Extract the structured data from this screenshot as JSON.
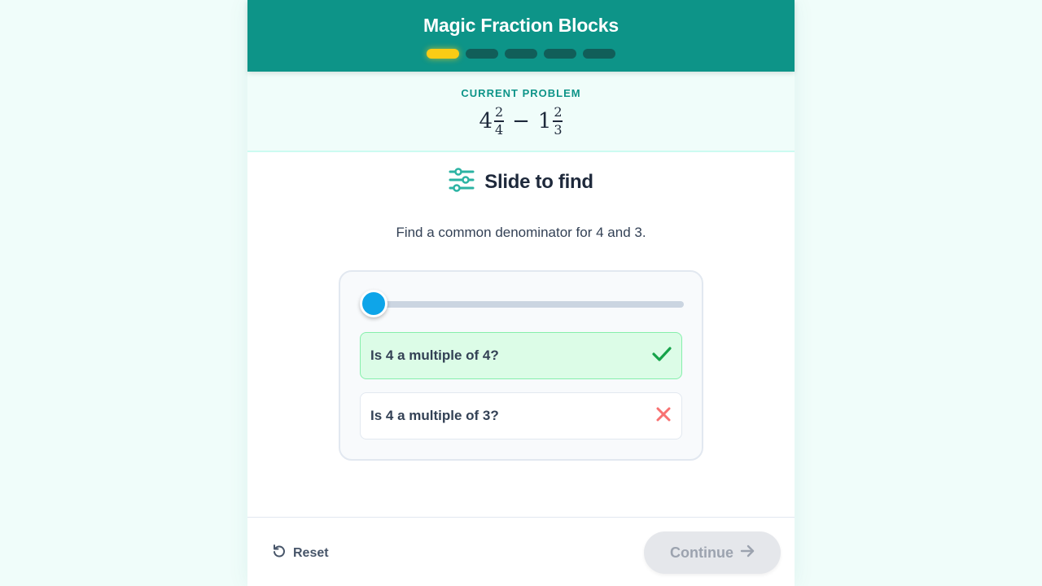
{
  "header": {
    "title": "Magic Fraction Blocks",
    "progress": {
      "total": 5,
      "current": 1
    },
    "colors": {
      "bar": "#0d9488",
      "active_step": "#facc15",
      "inactive_step": "#115e59"
    }
  },
  "problem": {
    "label": "CURRENT PROBLEM",
    "first": {
      "whole": "4",
      "numerator": "2",
      "denominator": "4"
    },
    "operator": "−",
    "second": {
      "whole": "1",
      "numerator": "2",
      "denominator": "3"
    }
  },
  "section": {
    "icon": "sliders-icon",
    "title": "Slide to find"
  },
  "instruction": "Find a common denominator for 4 and 3.",
  "slider": {
    "value": 4,
    "fill_fraction": 0,
    "color": "#0ea5e9"
  },
  "checks": [
    {
      "text": "Is 4 a multiple of 4?",
      "status": "correct",
      "icon": "check-icon"
    },
    {
      "text": "Is 4 a multiple of 3?",
      "status": "incorrect",
      "icon": "x-icon"
    }
  ],
  "footer": {
    "reset_label": "Reset",
    "reset_icon": "undo-icon",
    "continue_label": "Continue",
    "continue_icon": "arrow-right-icon",
    "continue_disabled": true
  }
}
